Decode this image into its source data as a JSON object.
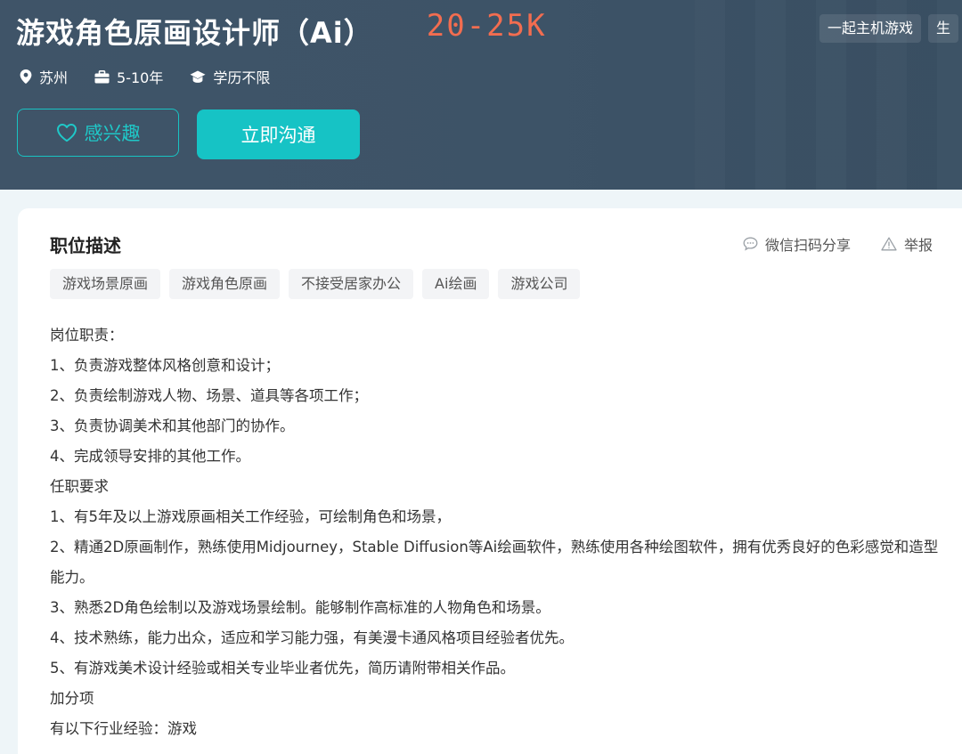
{
  "header": {
    "job_title": "游戏角色原画设计师（Ai）",
    "salary": "20-25K",
    "company_tags": [
      "一起主机游戏",
      "生"
    ],
    "meta": {
      "location": "苏州",
      "experience": "5-10年",
      "education": "学历不限"
    },
    "buttons": {
      "interest": "感兴趣",
      "chat": "立即沟通"
    }
  },
  "job": {
    "section_title": "职位描述",
    "share_label": "微信扫码分享",
    "report_label": "举报",
    "tags": [
      "游戏场景原画",
      "游戏角色原画",
      "不接受居家办公",
      "Ai绘画",
      "游戏公司"
    ],
    "description": [
      "岗位职责：",
      "1、负责游戏整体风格创意和设计；",
      "2、负责绘制游戏人物、场景、道具等各项工作；",
      "3、负责协调美术和其他部门的协作。",
      "4、完成领导安排的其他工作。",
      "任职要求",
      "1、有5年及以上游戏原画相关工作经验，可绘制角色和场景，",
      "2、精通2D原画制作，熟练使用Midjourney，Stable Diffusion等Ai绘画软件，熟练使用各种绘图软件，拥有优秀良好的色彩感觉和造型能力。",
      "3、熟悉2D角色绘制以及游戏场景绘制。能够制作高标准的人物角色和场景。",
      "4、技术熟练，能力出众，适应和学习能力强，有美漫卡通风格项目经验者优先。",
      "5、有游戏美术设计经验或相关专业毕业者优先，简历请附带相关作品。",
      "加分项",
      "有以下行业经验：游戏"
    ]
  },
  "colors": {
    "header_bg": "#3e5367",
    "salary": "#f26d50",
    "accent": "#16c3c5"
  }
}
